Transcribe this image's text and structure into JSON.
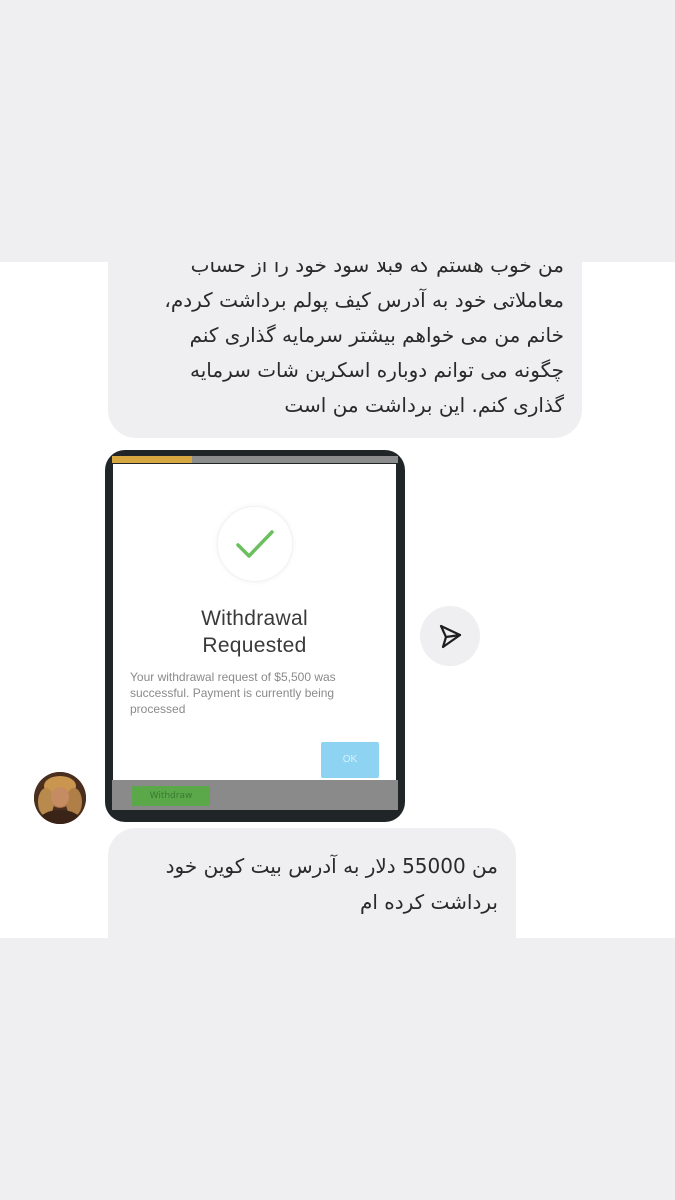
{
  "messages": [
    {
      "lines": [
        "من خوب هستم که قبلا سود خود را از حساب",
        "معاملاتی خود به آدرس کیف پولم برداشت کردم،",
        "خانم من می خواهم بیشتر سرمایه گذاری کنم",
        "چگونه می توانم دوباره اسکرین شات سرمایه",
        "گذاری کنم.  این برداشت من است"
      ]
    },
    {
      "lines": [
        "من 55000 دلار به آدرس بیت کوین خود",
        "برداشت کرده ام"
      ]
    }
  ],
  "shared_screenshot": {
    "title_line1": "Withdrawal",
    "title_line2": "Requested",
    "message": "Your withdrawal request of $5,500 was successful. Payment is currently being processed",
    "ok_label": "OK",
    "background_button_label": "Withdraw",
    "progress_fraction": 0.28,
    "check_icon": "check-icon",
    "accent_color": "#6abf5e"
  },
  "controls": {
    "share_icon": "send-icon",
    "avatar_icon": "user-avatar"
  }
}
